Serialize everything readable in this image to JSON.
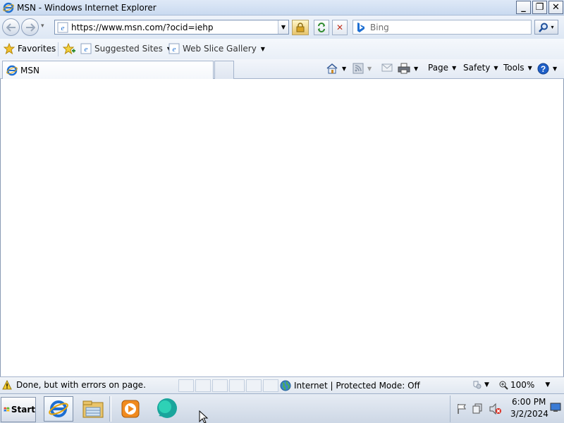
{
  "window": {
    "title": "MSN - Windows Internet Explorer",
    "minimize": "_",
    "restore": "❐",
    "close": "✕"
  },
  "nav": {
    "address": "https://www.msn.com/?ocid=iehp",
    "search_placeholder": "Bing",
    "dropdown_glyph": "▾"
  },
  "favorites_bar": {
    "favorites_label": "Favorites",
    "suggested_sites_label": "Suggested Sites",
    "web_slice_gallery_label": "Web Slice Gallery"
  },
  "command_bar": {
    "tab_label": "MSN",
    "page_label": "Page",
    "safety_label": "Safety",
    "tools_label": "Tools"
  },
  "status_bar": {
    "message": "Done, but with errors on page.",
    "zone": "Internet | Protected Mode: Off",
    "zoom": "100%"
  },
  "taskbar": {
    "start_label": "Start",
    "time": "6:00 PM",
    "date": "3/2/2024"
  },
  "colors": {
    "ie_blue": "#1e6fd2",
    "stop_red": "#c0301c",
    "lock_gold": "#e7c36b"
  }
}
